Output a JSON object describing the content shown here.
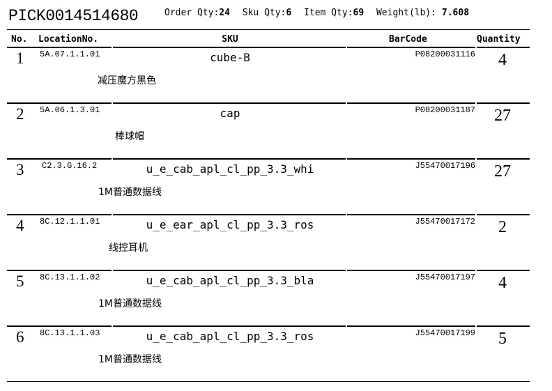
{
  "pick": {
    "id": "PICK0014514680",
    "order_qty_label": "Order Qty:",
    "order_qty": "24",
    "sku_qty_label": "Sku Qty:",
    "sku_qty": "6",
    "item_qty_label": "Item Qty:",
    "item_qty": "69",
    "weight_label": "Weight(lb):",
    "weight": "7.608"
  },
  "columns": {
    "no": "No.",
    "location": "LocationNo.",
    "sku": "SKU",
    "barcode": "BarCode",
    "quantity": "Quantity"
  },
  "rows": [
    {
      "no": "1",
      "location": "5A.07.1.1.01",
      "sku": "cube-B",
      "barcode": "P08200031116",
      "quantity": "4",
      "description": "减压魔方黑色"
    },
    {
      "no": "2",
      "location": "5A.06.1.3.01",
      "sku": "cap",
      "barcode": "P08200031187",
      "quantity": "27",
      "description": "棒球帽"
    },
    {
      "no": "3",
      "location": "C2.3.G.16.2",
      "sku": "u_e_cab_apl_cl_pp_3.3_whi",
      "barcode": "J55470017196",
      "quantity": "27",
      "description": "1M普通数据线"
    },
    {
      "no": "4",
      "location": "8C.12.1.1.01",
      "sku": "u_e_ear_apl_cl_pp_3.3_ros",
      "barcode": "J55470017172",
      "quantity": "2",
      "description": "线控耳机"
    },
    {
      "no": "5",
      "location": "8C.13.1.1.02",
      "sku": "u_e_cab_apl_cl_pp_3.3_bla",
      "barcode": "J55470017197",
      "quantity": "4",
      "description": "1M普通数据线"
    },
    {
      "no": "6",
      "location": "8C.13.1.1.03",
      "sku": "u_e_cab_apl_cl_pp_3.3_ros",
      "barcode": "J55470017199",
      "quantity": "5",
      "description": "1M普通数据线"
    }
  ]
}
